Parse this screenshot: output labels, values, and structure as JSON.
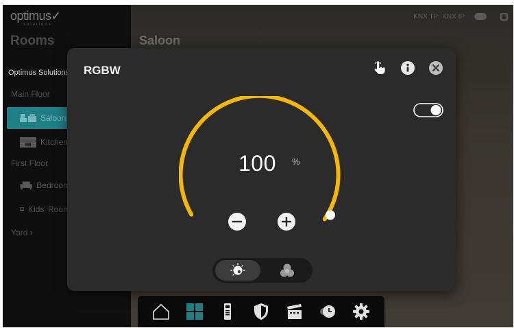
{
  "app": {
    "logo_text": "optimus",
    "logo_check": "✓",
    "logo_sub": "solutions"
  },
  "topbar": {
    "knx_tp": "KNX TP",
    "knx_ip": "KNX IP",
    "cloud_icon": "cloud-icon",
    "box_icon": "window-icon"
  },
  "sidebar": {
    "title": "Rooms",
    "building": "Optimus Solutions",
    "items": [
      {
        "type": "floor",
        "label": "Main Floor"
      },
      {
        "type": "room",
        "label": "Saloon",
        "icon": "sofa-icon",
        "active": true
      },
      {
        "type": "room",
        "label": "Kitchen",
        "icon": "kitchen-icon"
      },
      {
        "type": "floor",
        "label": "First Floor"
      },
      {
        "type": "room",
        "label": "Bedroom",
        "icon": "bed-icon"
      },
      {
        "type": "room",
        "label": "Kids' Room",
        "icon": "kids-room-icon"
      },
      {
        "type": "floor",
        "label": "Yard ›"
      }
    ]
  },
  "main": {
    "title": "Saloon"
  },
  "dialog": {
    "title": "RGBW",
    "icons": [
      "hand-pointer-icon",
      "info-icon",
      "close-icon"
    ],
    "power_on": true,
    "level_value": "100",
    "level_unit": "%",
    "level_percent": 100,
    "mode_selected": "dimmer",
    "modes": [
      "dimmer-icon",
      "color-mix-icon"
    ],
    "accent_color": "#f6b700"
  },
  "bottom_nav": {
    "items": [
      "home-icon",
      "grid-icon",
      "intercom-icon",
      "shield-icon",
      "scenes-icon",
      "timer-icon",
      "settings-icon"
    ],
    "active_index": 1,
    "active_color": "#1e7f86"
  }
}
